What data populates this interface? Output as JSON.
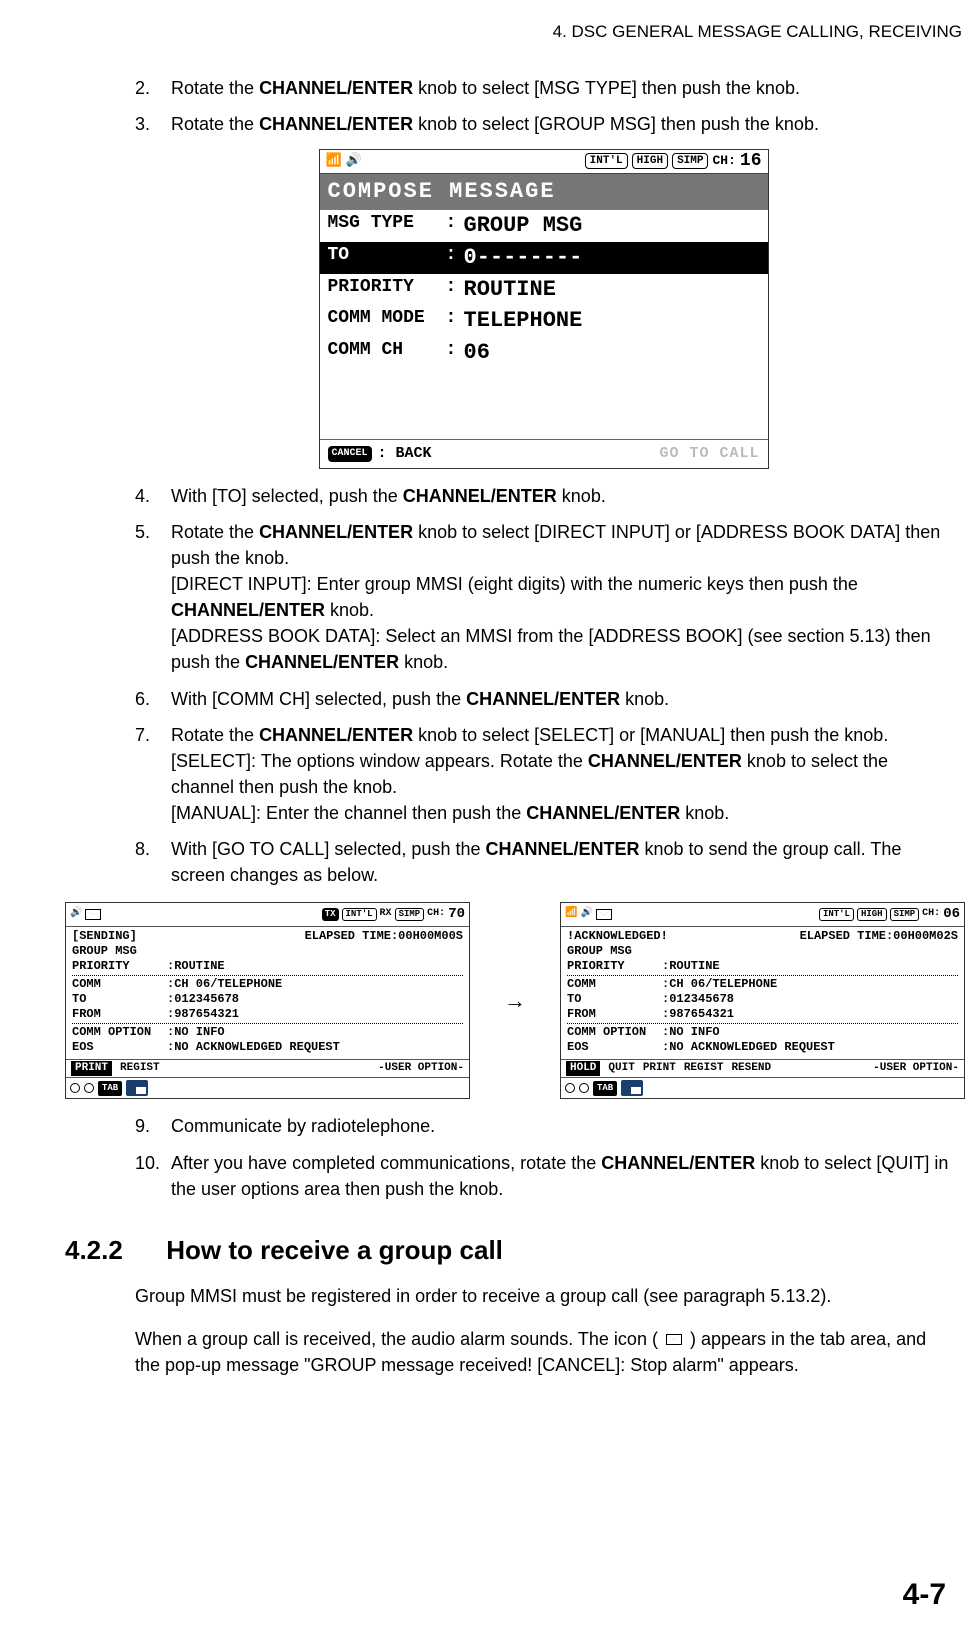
{
  "header": "4.  DSC GENERAL MESSAGE CALLING, RECEIVING",
  "step2": {
    "pre": "Rotate the ",
    "knob": "CHANNEL/ENTER",
    "post": " knob to select [MSG TYPE] then push the knob."
  },
  "step3": {
    "pre": "Rotate the ",
    "knob": "CHANNEL/ENTER",
    "post": " knob to select [GROUP MSG] then push the knob."
  },
  "compose": {
    "pills": {
      "intl": "INT'L",
      "high": "HIGH",
      "simp": "SIMP"
    },
    "ch_label": "CH:",
    "ch": "16",
    "title": "COMPOSE MESSAGE",
    "rows": {
      "msg_type_label": "MSG TYPE",
      "msg_type_value": "GROUP MSG",
      "to_label": "TO",
      "to_value": "0--------",
      "priority_label": "PRIORITY",
      "priority_value": "ROUTINE",
      "comm_mode_label": "COMM MODE",
      "comm_mode_value": "TELEPHONE",
      "comm_ch_label": "COMM CH",
      "comm_ch_value": "06"
    },
    "footer": {
      "cancel": "CANCEL",
      "back": ": BACK",
      "goto": "GO TO CALL"
    }
  },
  "step4": {
    "pre": "With [TO] selected, push the ",
    "knob": "CHANNEL/ENTER",
    "post": " knob."
  },
  "step5": {
    "line1_pre": "Rotate the ",
    "knob1": "CHANNEL/ENTER",
    "line1_post": " knob to select [DIRECT INPUT] or [ADDRESS BOOK DATA] then push the knob.",
    "line2_pre": "[DIRECT INPUT]: Enter group MMSI (eight digits) with the numeric keys then push the ",
    "knob2": "CHANNEL/ENTER",
    "line2_post": " knob.",
    "line3_pre": "[ADDRESS BOOK DATA]: Select an MMSI from the [ADDRESS BOOK] (see section 5.13) then push the ",
    "knob3": "CHANNEL/ENTER",
    "line3_post": " knob."
  },
  "step6": {
    "pre": "With [COMM CH] selected, push the ",
    "knob": "CHANNEL/ENTER",
    "post": " knob."
  },
  "step7": {
    "line1_pre": "Rotate the ",
    "knob1": "CHANNEL/ENTER",
    "line1_post": " knob to select [SELECT] or [MANUAL] then push the knob.",
    "line2_pre": "[SELECT]: The options window appears. Rotate the ",
    "knob2": "CHANNEL/ENTER",
    "line2_post": " knob to select the channel then push the knob.",
    "line3_pre": "[MANUAL]: Enter the channel then push the ",
    "knob3": "CHANNEL/ENTER",
    "line3_post": " knob."
  },
  "step8": {
    "pre": "With [GO TO CALL] selected, push the ",
    "knob": "CHANNEL/ENTER",
    "post": " knob to send the group call. The screen changes as below."
  },
  "left_screen": {
    "top": {
      "intl": "INT'L",
      "simp": "SIMP",
      "tx": "TX",
      "rx": "RX",
      "ch_label": "CH:",
      "ch": "70"
    },
    "status": "[SENDING]",
    "elapsed": "ELAPSED TIME:00H00M00S",
    "line1": "GROUP MSG",
    "priority_l": "PRIORITY",
    "priority_v": ":ROUTINE",
    "comm_l": "COMM",
    "comm_v": ":CH 06/TELEPHONE",
    "to_l": "TO",
    "to_v": ":012345678",
    "from_l": "FROM",
    "from_v": ":987654321",
    "opt_l": "COMM OPTION",
    "opt_v": ":NO INFO",
    "eos_l": "EOS",
    "eos_v": ":NO ACKNOWLEDGED REQUEST",
    "footer": {
      "print": "PRINT",
      "regist": "REGIST",
      "user": "-USER OPTION-"
    },
    "tab": "TAB"
  },
  "right_screen": {
    "top": {
      "intl": "INT'L",
      "high": "HIGH",
      "simp": "SIMP",
      "ch_label": "CH:",
      "ch": "06"
    },
    "status": "!ACKNOWLEDGED!",
    "elapsed": "ELAPSED TIME:00H00M02S",
    "line1": "GROUP MSG",
    "priority_l": "PRIORITY",
    "priority_v": ":ROUTINE",
    "comm_l": "COMM",
    "comm_v": ":CH 06/TELEPHONE",
    "to_l": "TO",
    "to_v": ":012345678",
    "from_l": "FROM",
    "from_v": ":987654321",
    "opt_l": "COMM OPTION",
    "opt_v": ":NO INFO",
    "eos_l": "EOS",
    "eos_v": ":NO ACKNOWLEDGED REQUEST",
    "footer": {
      "hold": "HOLD",
      "quit": "QUIT",
      "print": "PRINT",
      "regist": "REGIST",
      "resend": "RESEND",
      "user": "-USER OPTION-"
    },
    "tab": "TAB"
  },
  "step9": "Communicate by radiotelephone.",
  "step10": {
    "pre": "After you have completed communications, rotate the ",
    "knob": "CHANNEL/ENTER",
    "post": " knob to select [QUIT] in the user options area then push the knob."
  },
  "section": {
    "num": "4.2.2",
    "title": "How to receive a group call"
  },
  "para1": "Group MMSI must be registered in order to receive a group call (see paragraph 5.13.2).",
  "para2_pre": "When a group call is received, the audio alarm sounds. The icon (",
  "para2_post": ") appears in the tab area, and the pop-up message \"GROUP message received! [CANCEL]: Stop alarm\" appears.",
  "page_num": "4-7",
  "nums": {
    "n2": "2.",
    "n3": "3.",
    "n4": "4.",
    "n5": "5.",
    "n6": "6.",
    "n7": "7.",
    "n8": "8.",
    "n9": "9.",
    "n10": "10."
  }
}
